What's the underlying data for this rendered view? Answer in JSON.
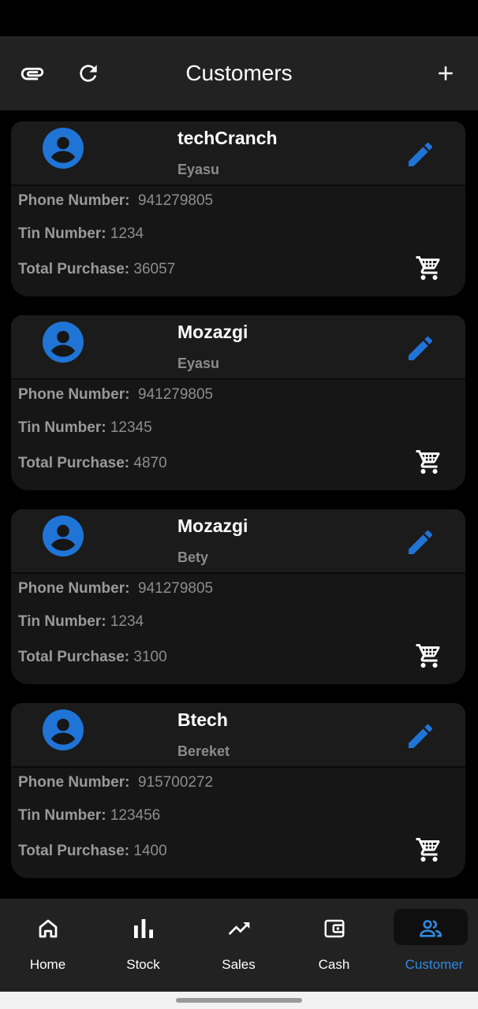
{
  "header": {
    "title": "Customers"
  },
  "customers": [
    {
      "name": "techCranch",
      "owner": "Eyasu",
      "phone_label": "Phone Number:",
      "phone": "941279805",
      "tin_label": "Tin Number:",
      "tin": "1234",
      "total_label": "Total Purchase:",
      "total": "36057"
    },
    {
      "name": "Mozazgi",
      "owner": "Eyasu",
      "phone_label": "Phone Number:",
      "phone": "941279805",
      "tin_label": "Tin Number:",
      "tin": "12345",
      "total_label": "Total Purchase:",
      "total": "4870"
    },
    {
      "name": "Mozazgi",
      "owner": "Bety",
      "phone_label": "Phone Number:",
      "phone": "941279805",
      "tin_label": "Tin Number:",
      "tin": "1234",
      "total_label": "Total Purchase:",
      "total": "3100"
    },
    {
      "name": "Btech",
      "owner": "Bereket",
      "phone_label": "Phone Number:",
      "phone": "915700272",
      "tin_label": "Tin Number:",
      "tin": "123456",
      "total_label": "Total Purchase:",
      "total": "1400"
    }
  ],
  "nav": {
    "items": [
      {
        "label": "Home",
        "icon": "home-icon"
      },
      {
        "label": "Stock",
        "icon": "bar-chart-icon"
      },
      {
        "label": "Sales",
        "icon": "trending-up-icon"
      },
      {
        "label": "Cash",
        "icon": "wallet-icon"
      },
      {
        "label": "Customer",
        "icon": "people-icon"
      }
    ],
    "active": "Customer"
  },
  "colors": {
    "accent": "#2f8ae0",
    "avatar": "#1f74d6",
    "bar_bg": "#222222",
    "card_bg": "#161616"
  }
}
